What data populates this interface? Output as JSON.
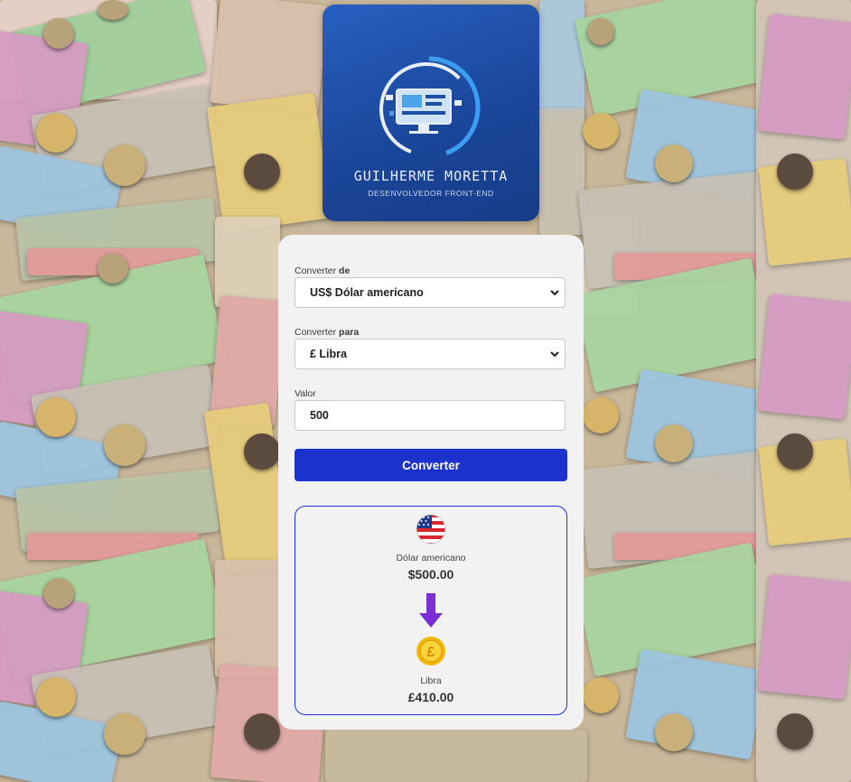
{
  "logo": {
    "name": "GUILHERME MORETTA",
    "subtitle": "DESENVOLVEDOR FRONT-END"
  },
  "form": {
    "from_label_prefix": "Converter",
    "from_label_bold": "de",
    "from_value": "US$ Dólar americano",
    "to_label_prefix": "Converter",
    "to_label_bold": "para",
    "to_value": "£ Libra",
    "amount_label": "Valor",
    "amount_value": "500",
    "convert_button": "Converter"
  },
  "result": {
    "from_currency_icon": "us-flag-icon",
    "from_currency_name": "Dólar americano",
    "from_amount": "$500.00",
    "arrow_icon": "arrow-down-icon",
    "to_currency_icon": "pound-coin-icon",
    "to_currency_name": "Libra",
    "to_amount": "£410.00"
  },
  "colors": {
    "accent": "#1b33cc",
    "arrow": "#7b2fd6",
    "card": "#f2f2f3"
  }
}
